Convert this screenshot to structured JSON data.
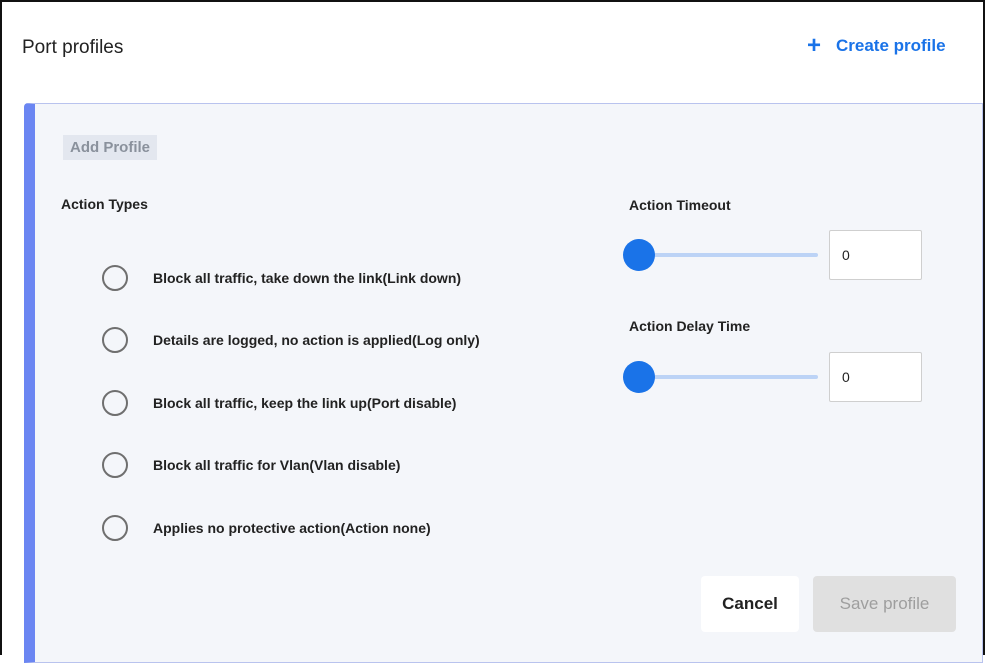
{
  "header": {
    "title": "Port profiles",
    "create_icon": "plus-icon",
    "create_label": "Create profile"
  },
  "form": {
    "tag_label": "Add Profile",
    "action_types_label": "Action Types",
    "action_types": [
      {
        "label": "Block all traffic, take down the link(Link down)",
        "selected": false
      },
      {
        "label": "Details are logged, no action is applied(Log only)",
        "selected": false
      },
      {
        "label": "Block all traffic, keep the link up(Port disable)",
        "selected": false
      },
      {
        "label": "Block all traffic for Vlan(Vlan disable)",
        "selected": false
      },
      {
        "label": "Applies no protective action(Action none)",
        "selected": false
      }
    ],
    "action_timeout": {
      "label": "Action Timeout",
      "value": "0",
      "slider_fraction": 0
    },
    "action_delay": {
      "label": "Action Delay Time",
      "value": "0",
      "slider_fraction": 0
    },
    "cancel_label": "Cancel",
    "save_label": "Save profile"
  },
  "colors": {
    "accent": "#1a73e8",
    "panel_border_accent": "#6b86f2",
    "panel_bg": "#f4f6fa"
  }
}
